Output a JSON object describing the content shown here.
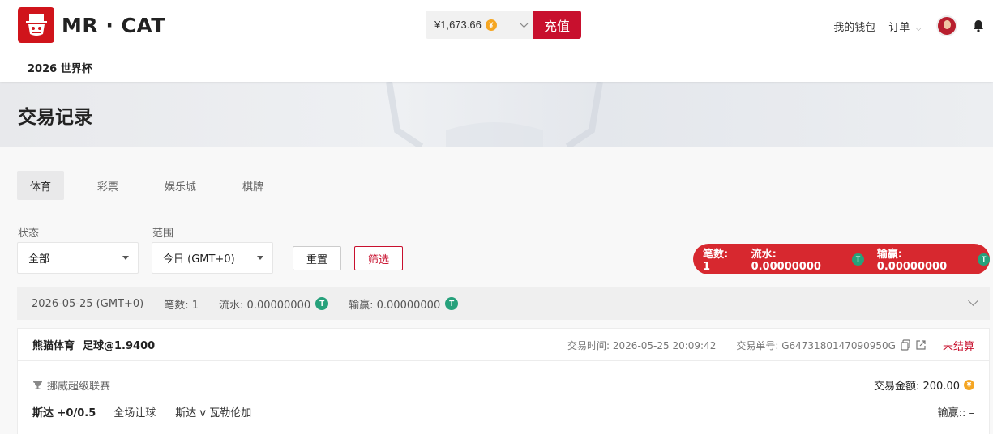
{
  "brand": {
    "name": "MR · CAT",
    "accent": "#d0141b"
  },
  "nav": {
    "sub_item": "2026 世界杯"
  },
  "header": {
    "balance": "¥1,673.66",
    "balance_coin": "¥",
    "recharge": "充值",
    "wallet": "我的钱包",
    "orders": "订单"
  },
  "page": {
    "title": "交易记录"
  },
  "tabs": [
    {
      "label": "体育",
      "active": true
    },
    {
      "label": "彩票",
      "active": false
    },
    {
      "label": "娱乐城",
      "active": false
    },
    {
      "label": "棋牌",
      "active": false
    }
  ],
  "filters": {
    "status_label": "状态",
    "status_value": "全部",
    "range_label": "范围",
    "range_value": "今日 (GMT+0)",
    "reset": "重置",
    "filter": "筛选"
  },
  "summary": {
    "count": "笔数: 1",
    "turnover": "流水: 0.00000000",
    "winloss": "输赢: 0.00000000",
    "currency_symbol": "T",
    "currency_color": "#26a17b"
  },
  "date_group": {
    "date": "2026-05-25 (GMT+0)",
    "count": "笔数: 1",
    "turnover": "流水: 0.00000000",
    "winloss": "输赢: 0.00000000"
  },
  "transaction": {
    "provider": "熊猫体育",
    "bet_type": "足球@1.9400",
    "time": "交易时间: 2026-05-25 20:09:42",
    "order_no": "交易单号: G6473180147090950G",
    "status": "未结算",
    "league": "挪威超级联赛",
    "amount": "交易金额: 200.00",
    "amount_coin": "¥",
    "pick": "斯达 +0/0.5",
    "market": "全场让球",
    "match": "斯达 v 瓦勒伦加",
    "winloss": "输赢:: –"
  }
}
